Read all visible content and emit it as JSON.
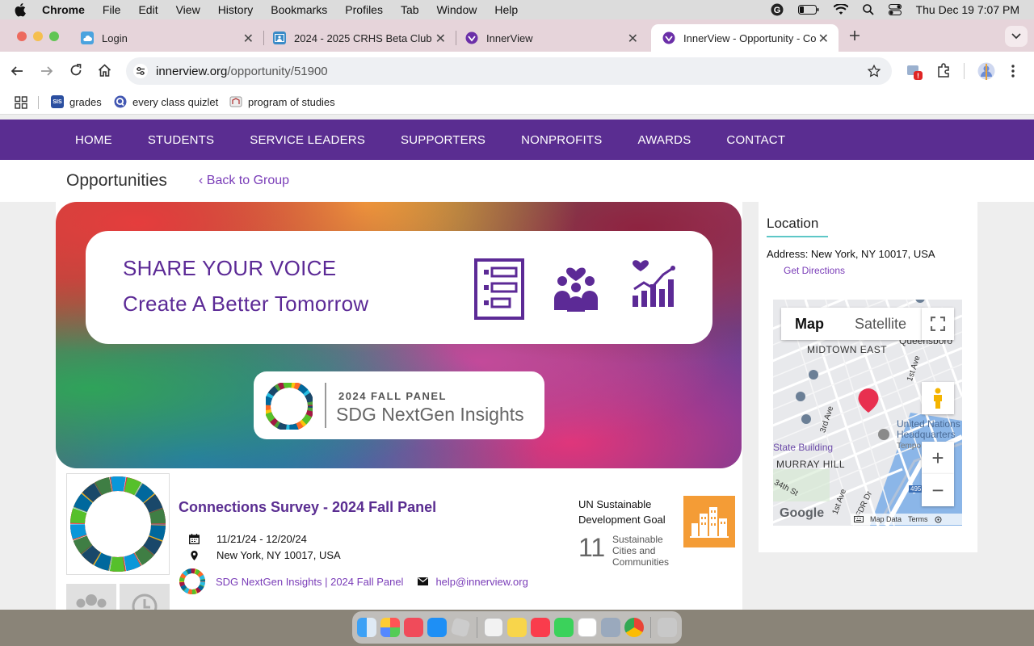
{
  "menubar": {
    "app": "Chrome",
    "items": [
      "File",
      "Edit",
      "View",
      "History",
      "Bookmarks",
      "Profiles",
      "Tab",
      "Window",
      "Help"
    ],
    "datetime": "Thu Dec 19  7:07 PM"
  },
  "tabs": [
    {
      "title": "Login",
      "fav_color": "#4aa3df"
    },
    {
      "title": "2024 - 2025 CRHS Beta Club",
      "fav_color": "#3a8bc7"
    },
    {
      "title": "InnerView",
      "fav_color": "#6b2fa8"
    },
    {
      "title": "InnerView - Opportunity - Co",
      "fav_color": "#6b2fa8"
    }
  ],
  "toolbar": {
    "url_domain": "innerview.org",
    "url_path": "/opportunity/51900"
  },
  "bookmarks": [
    {
      "label": "grades",
      "icon_text": "SIS",
      "color": "#2b4fa0"
    },
    {
      "label": "every class quizlet",
      "icon_text": "Q",
      "color": "#4257b2"
    },
    {
      "label": "program of studies",
      "icon_text": "",
      "color": "#777777"
    }
  ],
  "site_nav": [
    "HOME",
    "STUDENTS",
    "SERVICE LEADERS",
    "SUPPORTERS",
    "NONPROFITS",
    "AWARDS",
    "CONTACT"
  ],
  "subheader": {
    "title": "Opportunities",
    "back_link": "‹ Back to Group"
  },
  "banner": {
    "line1": "SHARE YOUR VOICE",
    "line2": "Create A Better Tomorrow",
    "panel_kicker": "2024 FALL PANEL",
    "panel_name": "SDG NextGen Insights"
  },
  "opportunity": {
    "title": "Connections Survey - 2024 Fall Panel",
    "dates": "11/21/24 - 12/20/24",
    "location": "New York, NY 10017, USA",
    "group_link": "SDG NextGen Insights | 2024 Fall Panel",
    "email": "help@innerview.org"
  },
  "sdg": {
    "heading": "UN Sustainable Development Goal",
    "number": "11",
    "name": "Sustainable Cities and Communities",
    "color": "#f49c36"
  },
  "location_panel": {
    "heading": "Location",
    "address": "Address: New York, NY 10017, USA",
    "directions": "Get Directions"
  },
  "map": {
    "type_map": "Map",
    "type_satellite": "Satellite",
    "labels": {
      "midtown_east": "MIDTOWN EAST",
      "queensboro": "Queensboro",
      "first_ave": "1st Ave",
      "third_ave": "3rd Ave",
      "un_hq": "United Nations Headquarters",
      "tempo": "Tempo",
      "state_building": "State Building",
      "murray_hill": "MURRAY HILL",
      "thirty_fourth": "34th St",
      "first_ave_2": "1st Ave",
      "fdr": "FDR Dr",
      "route": "495",
      "google": "Google",
      "map_data": "Map Data",
      "terms": "Terms"
    },
    "zoom_in": "+",
    "zoom_out": "−",
    "marker_color": "#e8304f"
  },
  "colors": {
    "brand_purple": "#5a2d91",
    "link_purple": "#7a3db8",
    "accent_teal": "#5ec7c7"
  }
}
